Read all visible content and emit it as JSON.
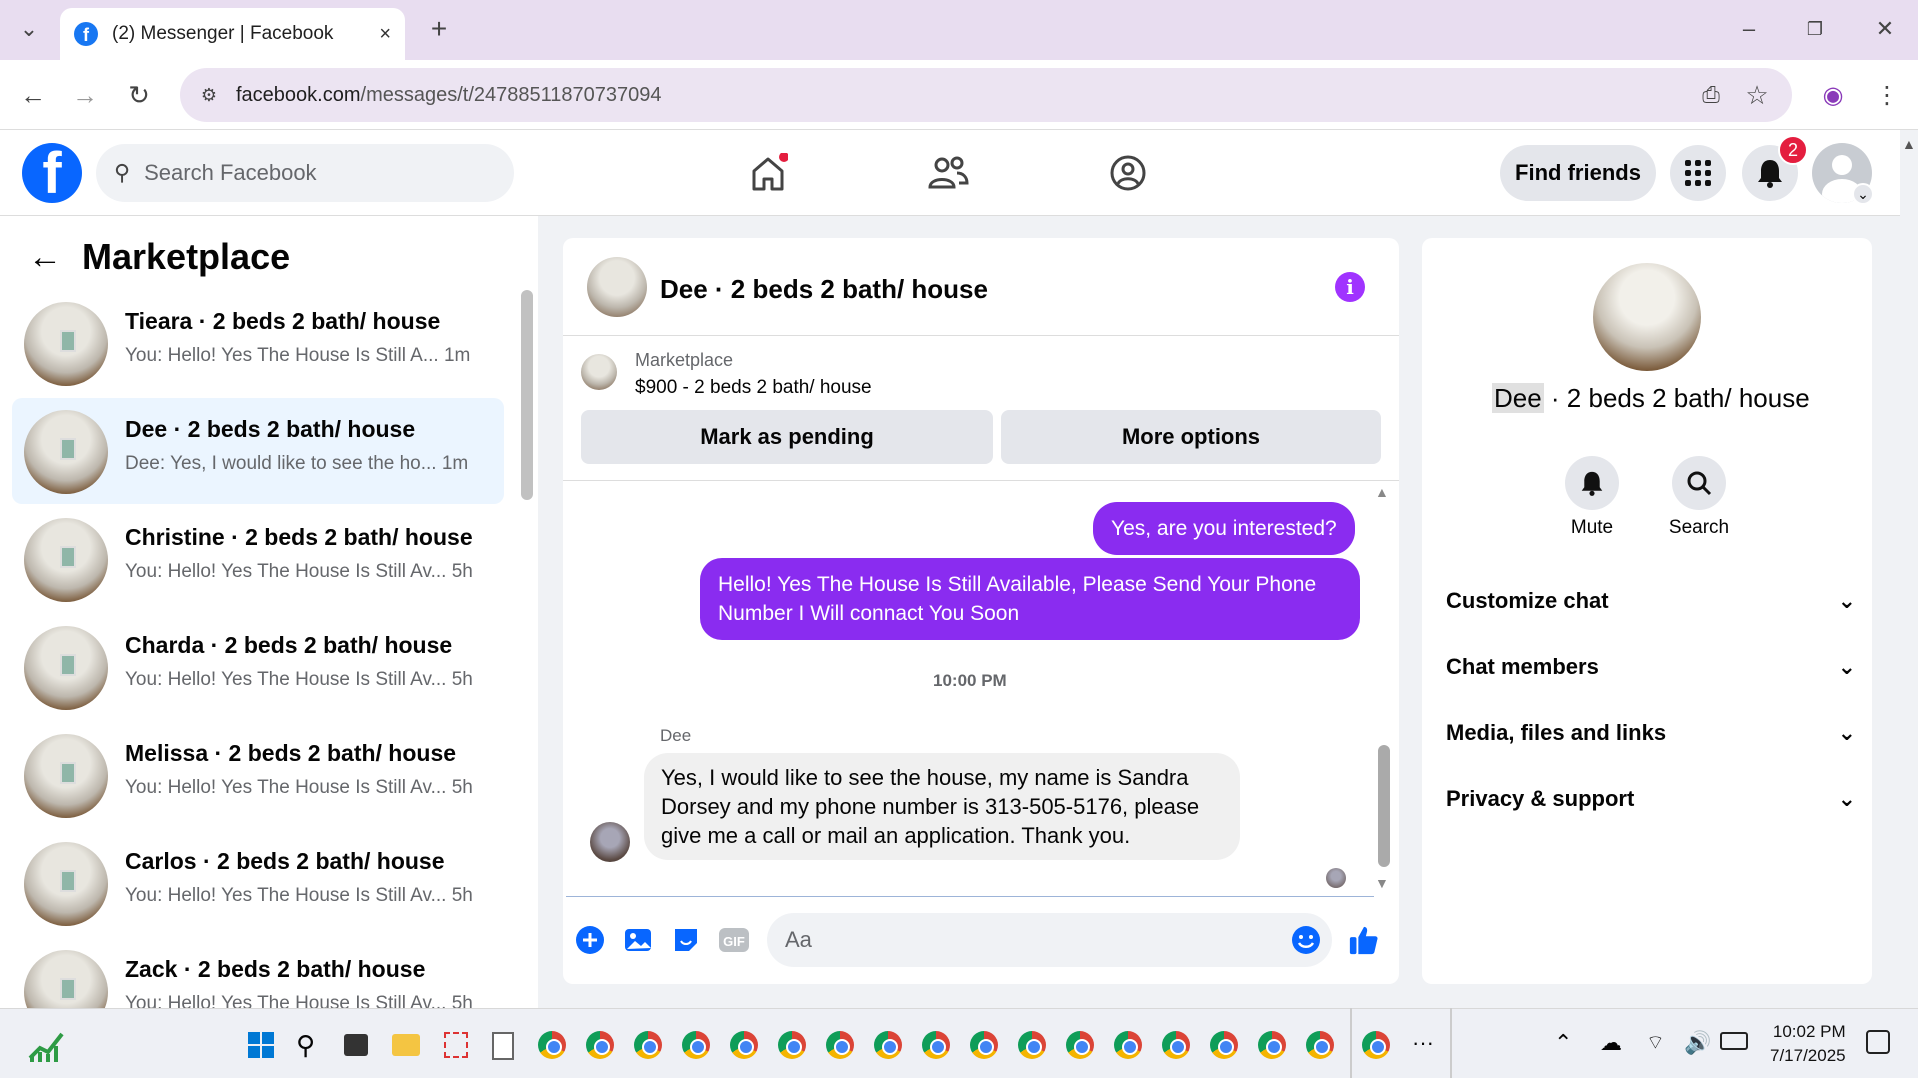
{
  "browser": {
    "tab_title": "(2) Messenger | Facebook",
    "tab_close": "×",
    "new_tab": "+",
    "url_host": "facebook.com",
    "url_path": "/messages/t/24788511870737094",
    "minimize": "–",
    "restore": "❐",
    "close": "✕"
  },
  "fb": {
    "logo": "f",
    "search_placeholder": "Search Facebook",
    "find_friends": "Find friends",
    "notif_count": "2"
  },
  "left": {
    "title": "Marketplace",
    "conversations": [
      {
        "name": "Tieara · 2 beds 2 bath/ house",
        "preview": "You: Hello! Yes The House Is Still A...  1m"
      },
      {
        "name": "Dee · 2 beds 2 bath/ house",
        "preview": "Dee: Yes, I would like to see the ho...  1m"
      },
      {
        "name": "Christine · 2 beds 2 bath/ house",
        "preview": "You: Hello! Yes The House Is Still Av...  5h"
      },
      {
        "name": "Charda · 2 beds 2 bath/ house",
        "preview": "You: Hello! Yes The House Is Still Av...  5h"
      },
      {
        "name": "Melissa · 2 beds 2 bath/ house",
        "preview": "You: Hello! Yes The House Is Still Av...  5h"
      },
      {
        "name": "Carlos · 2 beds 2 bath/ house",
        "preview": "You: Hello! Yes The House Is Still Av...  5h"
      },
      {
        "name": "Zack · 2 beds 2 bath/ house",
        "preview": "You: Hello! Yes The House Is Still Av...  5h"
      }
    ]
  },
  "chat": {
    "title": "Dee · 2 beds 2 bath/ house",
    "info": "i",
    "marketplace_label": "Marketplace",
    "listing": "$900 - 2 beds 2 bath/ house",
    "mark_pending": "Mark as pending",
    "more_options": "More options",
    "msg_out_1": "Yes, are you interested?",
    "msg_out_2": "Hello! Yes The House  Is Still Available, Please Send Your Phone Number I Will connact You Soon",
    "timestamp": "10:00 PM",
    "sender": "Dee",
    "msg_in": "Yes, I would like to see the house, my name is Sandra Dorsey and my phone number is 313-505-5176, please give me a call or mail an application. Thank you.",
    "input_placeholder": "Aa"
  },
  "right": {
    "name_first": "Dee",
    "name_rest": " · 2 beds 2 bath/ house",
    "mute": "Mute",
    "search": "Search",
    "sections": [
      "Customize chat",
      "Chat members",
      "Media, files and links",
      "Privacy & support"
    ]
  },
  "taskbar": {
    "time": "10:02 PM",
    "date": "7/17/2025",
    "more": "···"
  }
}
